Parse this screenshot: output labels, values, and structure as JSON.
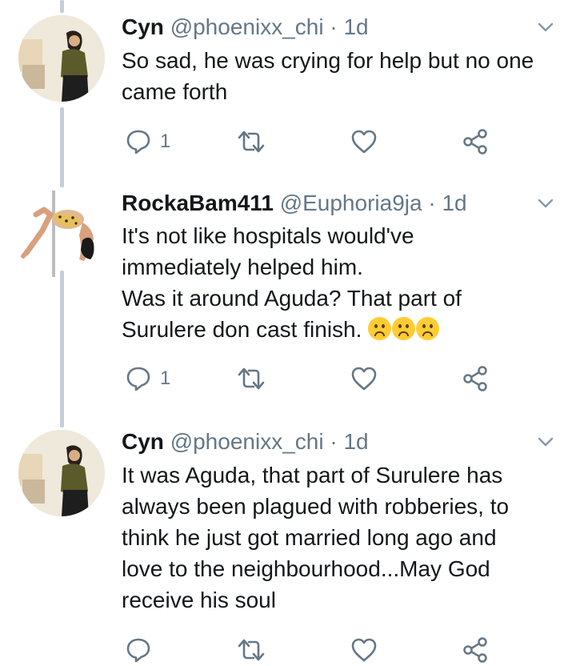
{
  "tweets": [
    {
      "name": "Cyn",
      "handle": "@phoenixx_chi",
      "separator": "·",
      "time": "1d",
      "lines": [
        "So sad, he was crying for help but no one",
        "came forth"
      ],
      "reply_count": "1",
      "avatar": "cyn-avatar-photo"
    },
    {
      "name": "RockaBam411",
      "handle": "@Euphoria9ja",
      "separator": "·",
      "time": "1d",
      "lines": [
        "It's not like hospitals would've",
        "immediately helped him.",
        "Was it around Aguda? That part of",
        "Surulere don cast finish."
      ],
      "emojis": [
        "frowning-face",
        "frowning-face",
        "frowning-face"
      ],
      "reply_count": "1",
      "avatar": "pole-dancer-avatar"
    },
    {
      "name": "Cyn",
      "handle": "@phoenixx_chi",
      "separator": "·",
      "time": "1d",
      "lines": [
        "It was Aguda, that part of Surulere has",
        "always been plagued with robberies, to",
        "think he just got married long ago and",
        "love to the neighbourhood...May God",
        "receive his soul"
      ],
      "avatar": "cyn-avatar-photo"
    }
  ],
  "icons": {
    "reply": "reply-bubble-icon",
    "retweet": "retweet-icon",
    "like": "heart-icon",
    "share": "share-icon",
    "more": "chevron-down-icon"
  },
  "colors": {
    "text": "#14171a",
    "secondary": "#657786",
    "thread_line": "#c4ced6",
    "icon": "#657786"
  }
}
